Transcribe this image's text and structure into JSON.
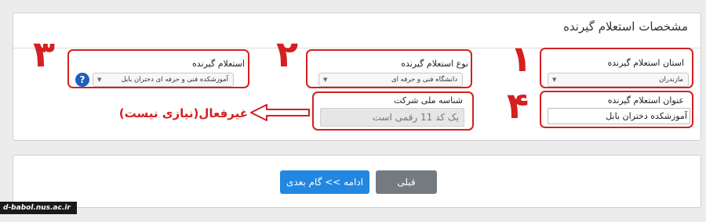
{
  "panel": {
    "title": "مشخصات استعلام گیرنده"
  },
  "fields": {
    "province": {
      "label": "استان استعلام گیرنده",
      "value": "مازندران"
    },
    "type": {
      "label": "نوع استعلام گیرنده",
      "value": "دانشگاه فنی و حرفه ای"
    },
    "recipient": {
      "label": "استعلام گیرنده",
      "value": "آموزشکده فنی و حرفه ای دختران بابل"
    },
    "national_id": {
      "label": "شناسه ملی شرکت",
      "placeholder": "یک کد 11 رقمی است"
    },
    "recipient_title": {
      "label": "عنوان استعلام گیرنده",
      "value": "آموزشکده دختران بابل"
    }
  },
  "help": {
    "icon": "question-icon",
    "glyph": "?"
  },
  "annotations": {
    "num1": "۱",
    "num2": "۲",
    "num3": "۳",
    "num4": "۴",
    "disabled_note": "غیرفعال(نیازی نیست)"
  },
  "nav": {
    "next_label": "ادامه >> گام بعدی",
    "prev_label": "قبلی"
  },
  "watermark": "d-babol.nus.ac.ir",
  "colors": {
    "annotation": "#d42020",
    "primary": "#2287e0",
    "secondary": "#747a80",
    "help": "#1b5fc1"
  }
}
